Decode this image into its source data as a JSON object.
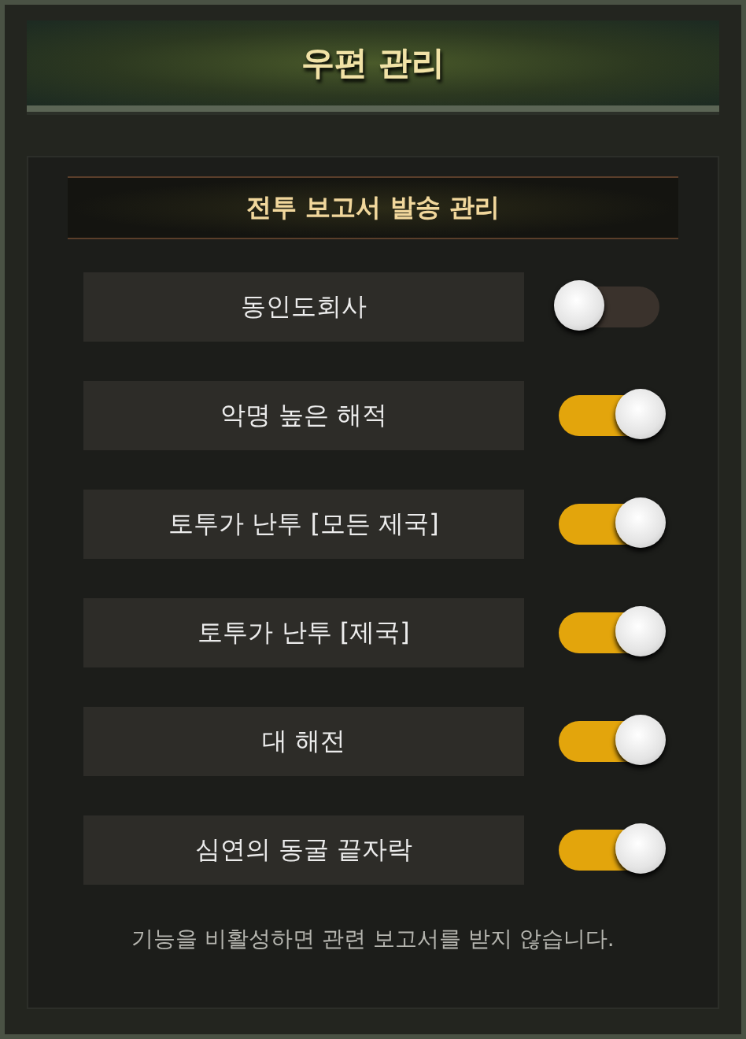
{
  "window": {
    "title": "우편 관리"
  },
  "section": {
    "title": "전투 보고서 발송 관리"
  },
  "settings": [
    {
      "label": "동인도회사",
      "on": false
    },
    {
      "label": "악명 높은 해적",
      "on": true
    },
    {
      "label": "토투가 난투 [모든 제국]",
      "on": true
    },
    {
      "label": "토투가 난투 [제국]",
      "on": true
    },
    {
      "label": "대 해전",
      "on": true
    },
    {
      "label": "심연의 동굴 끝자락",
      "on": true
    }
  ],
  "footer_note": "기능을 비활성하면 관련 보고서를 받지 않습니다."
}
